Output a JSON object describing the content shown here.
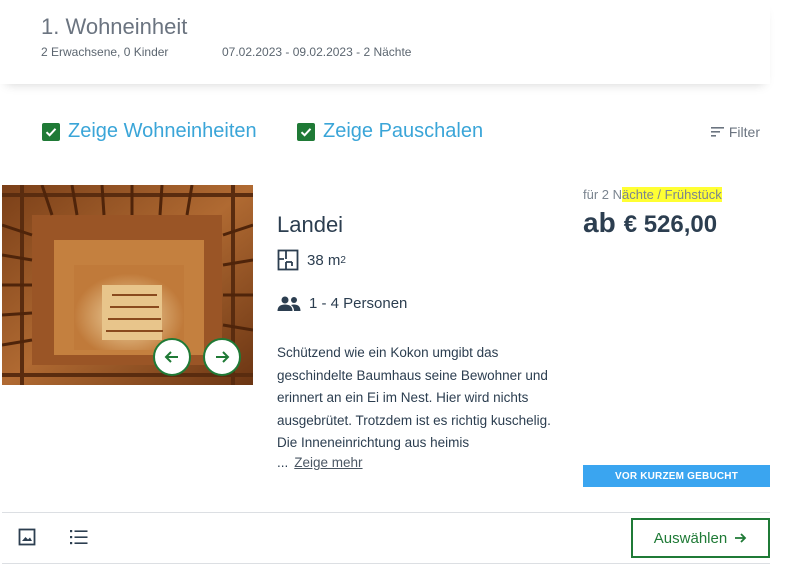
{
  "header": {
    "unit_title": "1. Wohneinheit",
    "guests": "2 Erwachsene, 0 Kinder",
    "dates": "07.02.2023 - 09.02.2023 - 2 Nächte"
  },
  "toggles": {
    "units_label": "Zeige Wohneinheiten",
    "units_checked": true,
    "packages_label": "Zeige Pauschalen",
    "packages_checked": true
  },
  "filter": {
    "label": "Filter",
    "icon": "filter-lines-icon"
  },
  "room": {
    "name": "Landei",
    "size_value": "38 m",
    "size_unit_sup": "2",
    "persons": "1 - 4 Personen",
    "description": "Schützend wie ein Kokon umgibt das geschindelte Baumhaus seine Bewohner und erinnert an ein Ei im Nest. Hier wird nichts ausgebrütet. Trotzdem ist es richtig kuschelig. Die Inneneinrichtung aus heimis",
    "ellipsis": "...",
    "more_label": "Zeige mehr"
  },
  "price": {
    "note_prefix": "für 2 N",
    "note_highlight": "ächte / Frühstück",
    "ab": "ab",
    "amount": "€ 526,00"
  },
  "badge": "VOR KURZEM GEBUCHT",
  "footer": {
    "select_label": "Auswählen"
  },
  "colors": {
    "brand_green": "#1f7a36",
    "link_blue": "#3aa5d8",
    "badge_blue": "#3aa5f0",
    "highlight": "#ffff33"
  }
}
